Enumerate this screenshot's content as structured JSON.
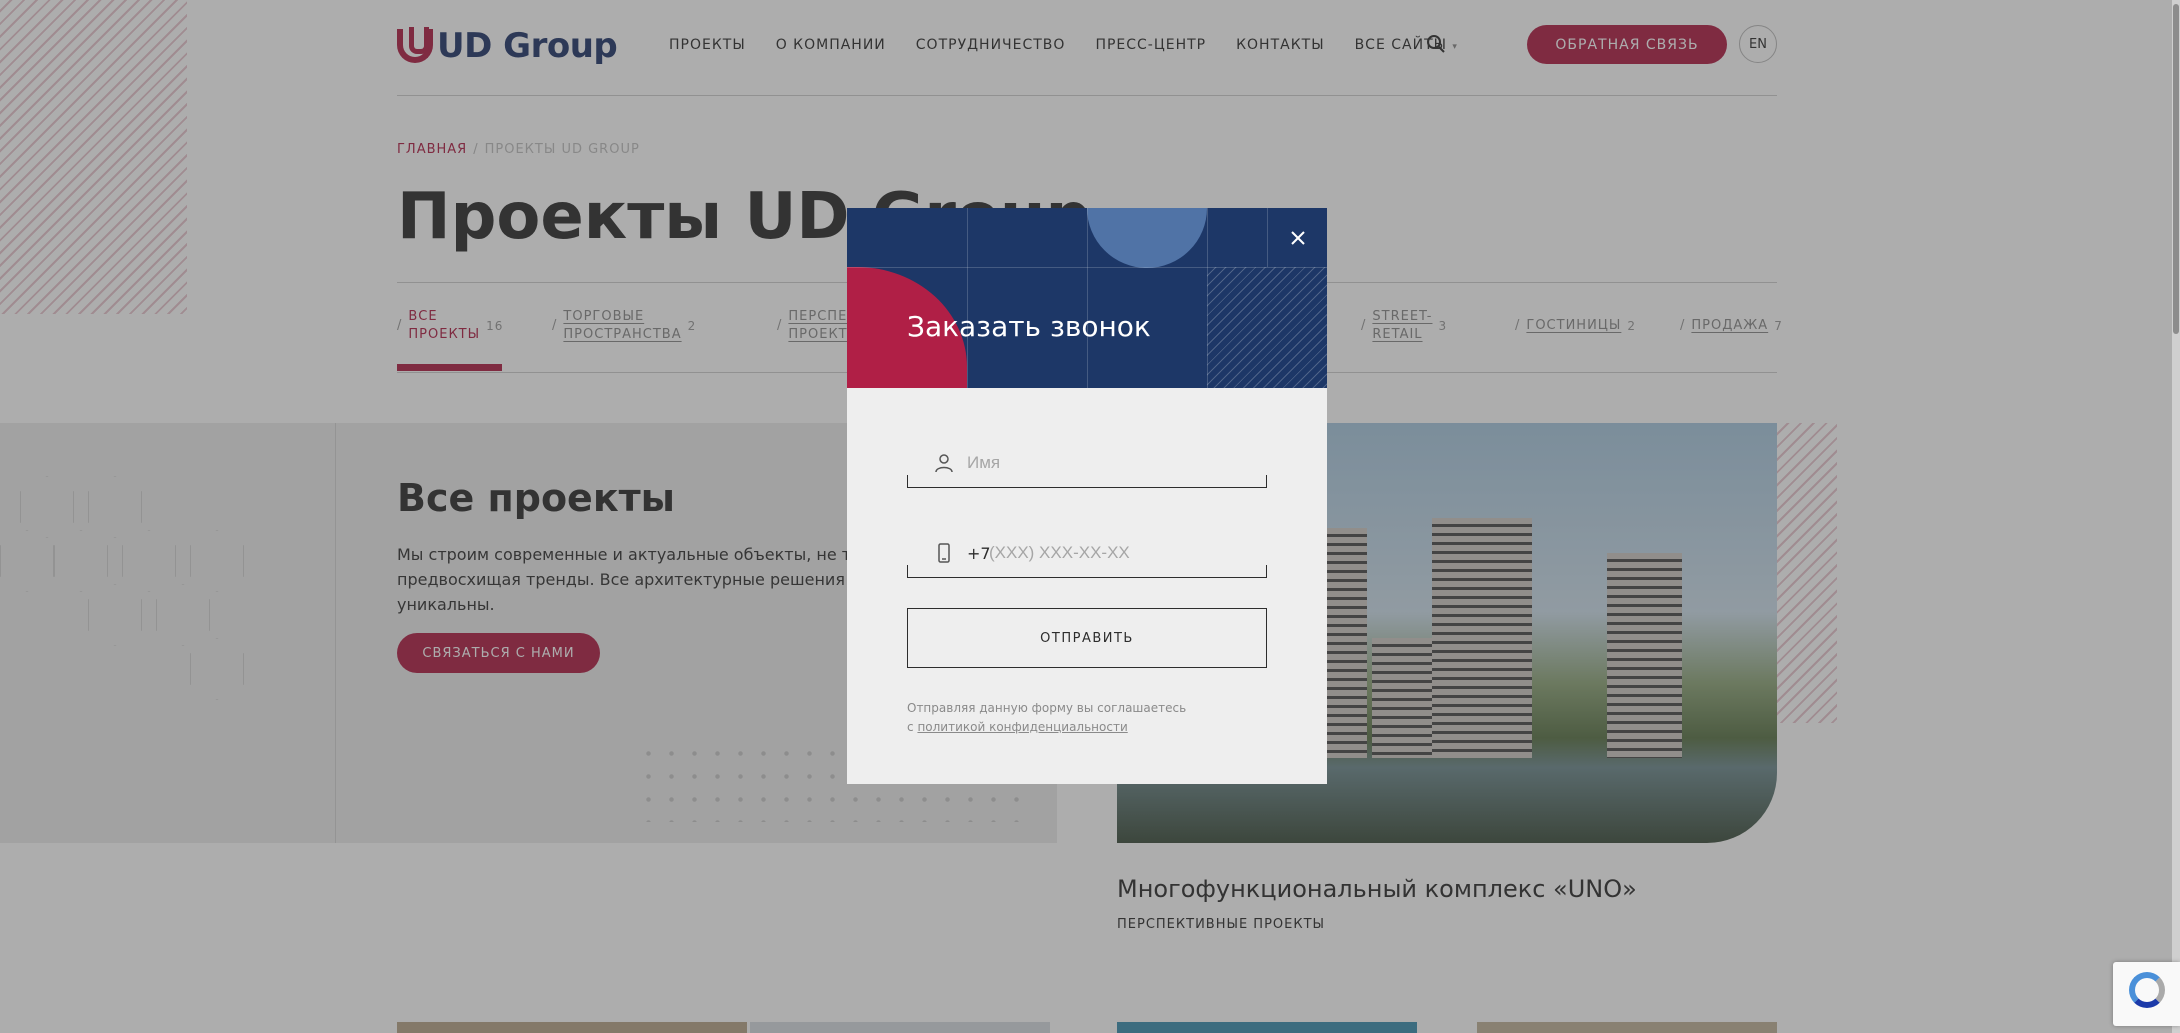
{
  "header": {
    "logo_text": "UD Group",
    "nav": [
      "ПРОЕКТЫ",
      "О КОМПАНИИ",
      "СОТРУДНИЧЕСТВО",
      "ПРЕСС-ЦЕНТР",
      "КОНТАКТЫ",
      "ВСЕ САЙТЫ"
    ],
    "feedback_label": "ОБРАТНАЯ СВЯЗЬ",
    "lang_label": "EN"
  },
  "breadcrumb": {
    "home": "ГЛАВНАЯ",
    "separator": "/",
    "current": "ПРОЕКТЫ UD GROUP"
  },
  "page_title": "Проекты UD Group",
  "tabs": [
    {
      "line1": "ВСЕ",
      "line2": "ПРОЕКТЫ",
      "count": "16"
    },
    {
      "line1": "ТОРГОВЫЕ",
      "line2": "ПРОСТРАНСТВА",
      "count": "2"
    },
    {
      "line1": "ПЕРСПЕКТИВНЫЕ",
      "line2": "ПРОЕКТЫ",
      "count": ""
    },
    {
      "line1": "STREET-",
      "line2": "RETAIL",
      "count": "3"
    },
    {
      "line1": "ГОСТИНИЦЫ",
      "line2": "",
      "count": "2"
    },
    {
      "line1": "ПРОДАЖА",
      "line2": "",
      "count": "7"
    }
  ],
  "hero": {
    "title": "Все проекты",
    "text": "Мы строим современные и актуальные объекты, не только по предвосхищая тренды. Все архитектурные решения и конце уникальны.",
    "button": "СВЯЗАТЬСЯ С НАМИ"
  },
  "project": {
    "name": "Многофункциональный комплекс «UNO»",
    "category": "ПЕРСПЕКТИВНЫЕ ПРОЕКТЫ"
  },
  "modal": {
    "title": "Заказать звонок",
    "name_placeholder": "Имя",
    "phone_prefix": "+7",
    "phone_placeholder": "(XXX) XXX-XX-XX",
    "submit_label": "ОТПРАВИТЬ",
    "consent_text": "Отправляя данную форму вы соглашаетесь",
    "consent_prefix": "с",
    "consent_link": "политикой конфиденциальности"
  },
  "icons": {
    "search": "search-icon",
    "close": "close-icon",
    "user": "user-icon",
    "phone": "phone-icon",
    "chevron": "chevron-down-icon"
  },
  "colors": {
    "accent": "#b01f46",
    "navy": "#1d3767",
    "modal_bg": "#eeeeee"
  }
}
